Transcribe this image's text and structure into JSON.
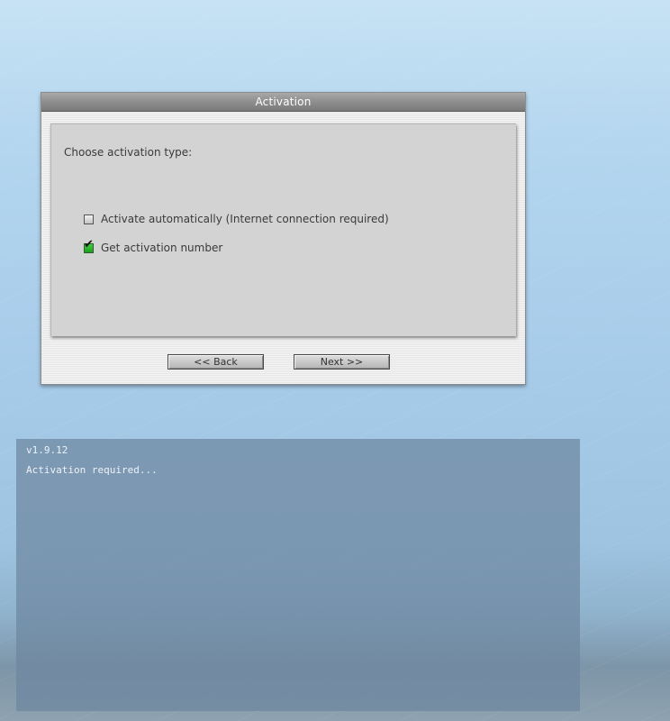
{
  "dialog": {
    "title": "Activation",
    "prompt": "Choose activation type:",
    "options": [
      {
        "label": "Activate automatically (Internet connection required)",
        "checked": false
      },
      {
        "label": "Get activation number",
        "checked": true
      }
    ],
    "back_label": "<< Back",
    "next_label": "Next >>"
  },
  "console": {
    "version": "v1.9.12",
    "status": "Activation required..."
  },
  "icons": {
    "checkmark": "checkmark-icon"
  },
  "colors": {
    "checkbox_checked": "#2db32d",
    "title_bar": "#8e8e8e",
    "panel": "#d3d3d3",
    "console_bg": "#6e87a0"
  }
}
